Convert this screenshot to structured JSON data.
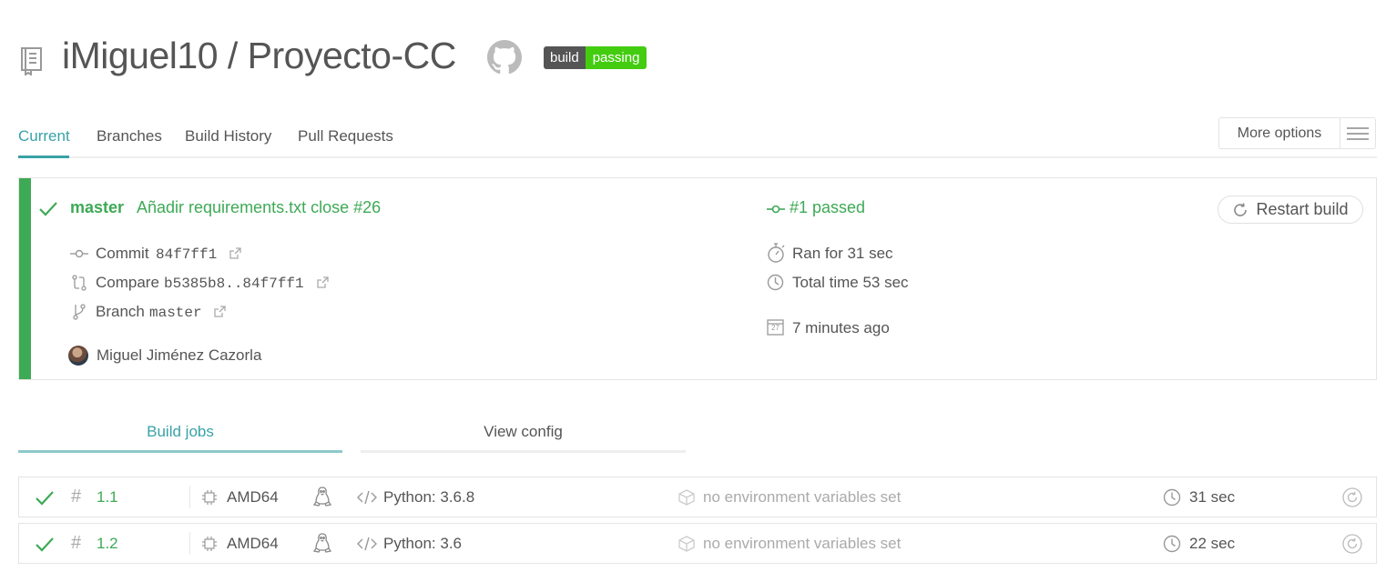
{
  "header": {
    "repo_title": "iMiguel10 / Proyecto-CC",
    "badge": {
      "left": "build",
      "right": "passing"
    }
  },
  "tabs": [
    {
      "label": "Current",
      "active": true
    },
    {
      "label": "Branches"
    },
    {
      "label": "Build History"
    },
    {
      "label": "Pull Requests"
    }
  ],
  "more_options": "More options",
  "build": {
    "branch": "master",
    "message": "Añadir requirements.txt close #26",
    "status": "#1 passed",
    "restart_label": "Restart build",
    "commit_label": "Commit",
    "commit_value": "84f7ff1",
    "compare_label": "Compare",
    "compare_value": "b5385b8..84f7ff1",
    "branch_label": "Branch",
    "branch_value": "master",
    "author": "Miguel Jiménez Cazorla",
    "ran_for": "Ran for 31 sec",
    "total_time": "Total time 53 sec",
    "date_icon_text": "27",
    "finished": "7 minutes ago"
  },
  "job_tabs": [
    {
      "label": "Build jobs",
      "active": true
    },
    {
      "label": "View config"
    }
  ],
  "jobs": [
    {
      "number": "1.1",
      "arch": "AMD64",
      "language": "Python: 3.6.8",
      "env": "no environment variables set",
      "duration": "31 sec"
    },
    {
      "number": "1.2",
      "arch": "AMD64",
      "language": "Python: 3.6",
      "env": "no environment variables set",
      "duration": "22 sec"
    }
  ],
  "colors": {
    "passed": "#3eaa56",
    "accent": "#39a2a6",
    "badge_green": "#44cc11"
  }
}
